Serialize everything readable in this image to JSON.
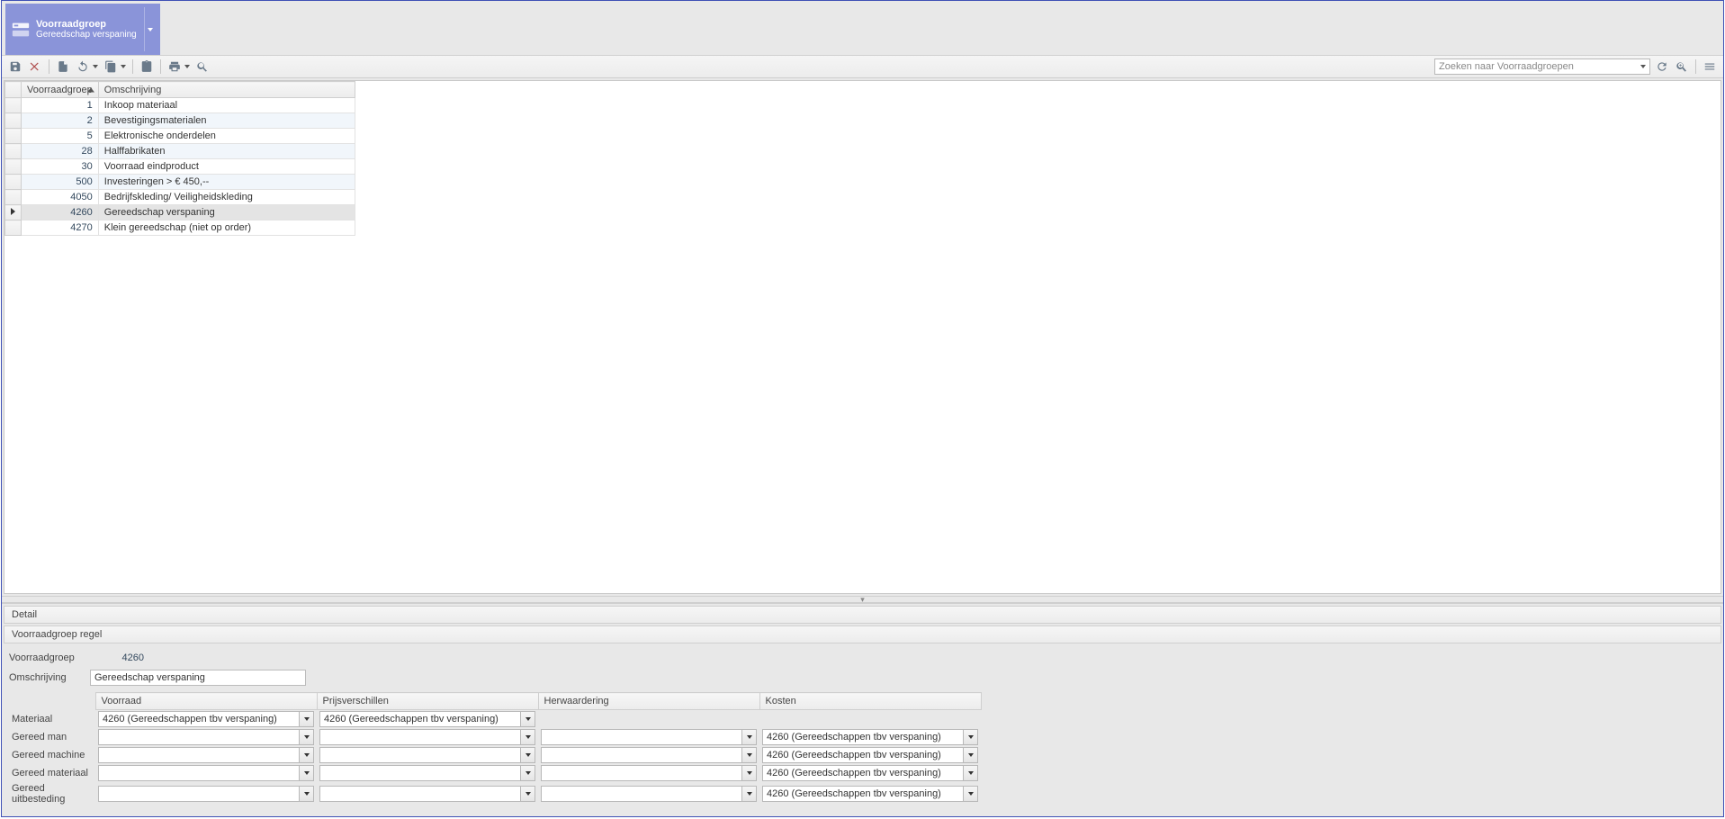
{
  "ribbon": {
    "title": "Voorraadgroep",
    "subtitle": "Gereedschap verspaning"
  },
  "toolbar": {
    "search_placeholder": "Zoeken naar Voorraadgroepen"
  },
  "grid": {
    "columns": {
      "id": "Voorraadgroep",
      "desc": "Omschrijving"
    },
    "rows": [
      {
        "id": "1",
        "desc": "Inkoop materiaal",
        "alt": false,
        "selected": false
      },
      {
        "id": "2",
        "desc": "Bevestigingsmaterialen",
        "alt": true,
        "selected": false
      },
      {
        "id": "5",
        "desc": "Elektronische onderdelen",
        "alt": false,
        "selected": false
      },
      {
        "id": "28",
        "desc": "Halffabrikaten",
        "alt": true,
        "selected": false
      },
      {
        "id": "30",
        "desc": "Voorraad eindproduct",
        "alt": false,
        "selected": false
      },
      {
        "id": "500",
        "desc": "Investeringen > € 450,--",
        "alt": true,
        "selected": false
      },
      {
        "id": "4050",
        "desc": "Bedrijfskleding/ Veiligheidskleding",
        "alt": false,
        "selected": false
      },
      {
        "id": "4260",
        "desc": "Gereedschap verspaning",
        "alt": false,
        "selected": true
      },
      {
        "id": "4270",
        "desc": "Klein gereedschap (niet op order)",
        "alt": false,
        "selected": false
      }
    ]
  },
  "detail": {
    "panel_title": "Detail",
    "group_title": "Voorraadgroep regel",
    "fields": {
      "voorraadgroep_label": "Voorraadgroep",
      "voorraadgroep_value": "4260",
      "omschrijving_label": "Omschrijving",
      "omschrijving_value": "Gereedschap verspaning"
    },
    "matrix": {
      "col_headers": [
        "Voorraad",
        "Prijsverschillen",
        "Herwaardering",
        "Kosten"
      ],
      "row_labels": [
        "Materiaal",
        "Gereed man",
        "Gereed machine",
        "Gereed materiaal",
        "Gereed uitbesteding"
      ],
      "option_text": "4260 (Gereedschappen tbv verspaning)",
      "cells": [
        [
          "filled",
          "filled",
          "blank",
          "blank"
        ],
        [
          "empty",
          "empty",
          "empty",
          "filled"
        ],
        [
          "empty",
          "empty",
          "empty",
          "filled"
        ],
        [
          "empty",
          "empty",
          "empty",
          "filled"
        ],
        [
          "empty",
          "empty",
          "empty",
          "filled"
        ]
      ]
    }
  }
}
